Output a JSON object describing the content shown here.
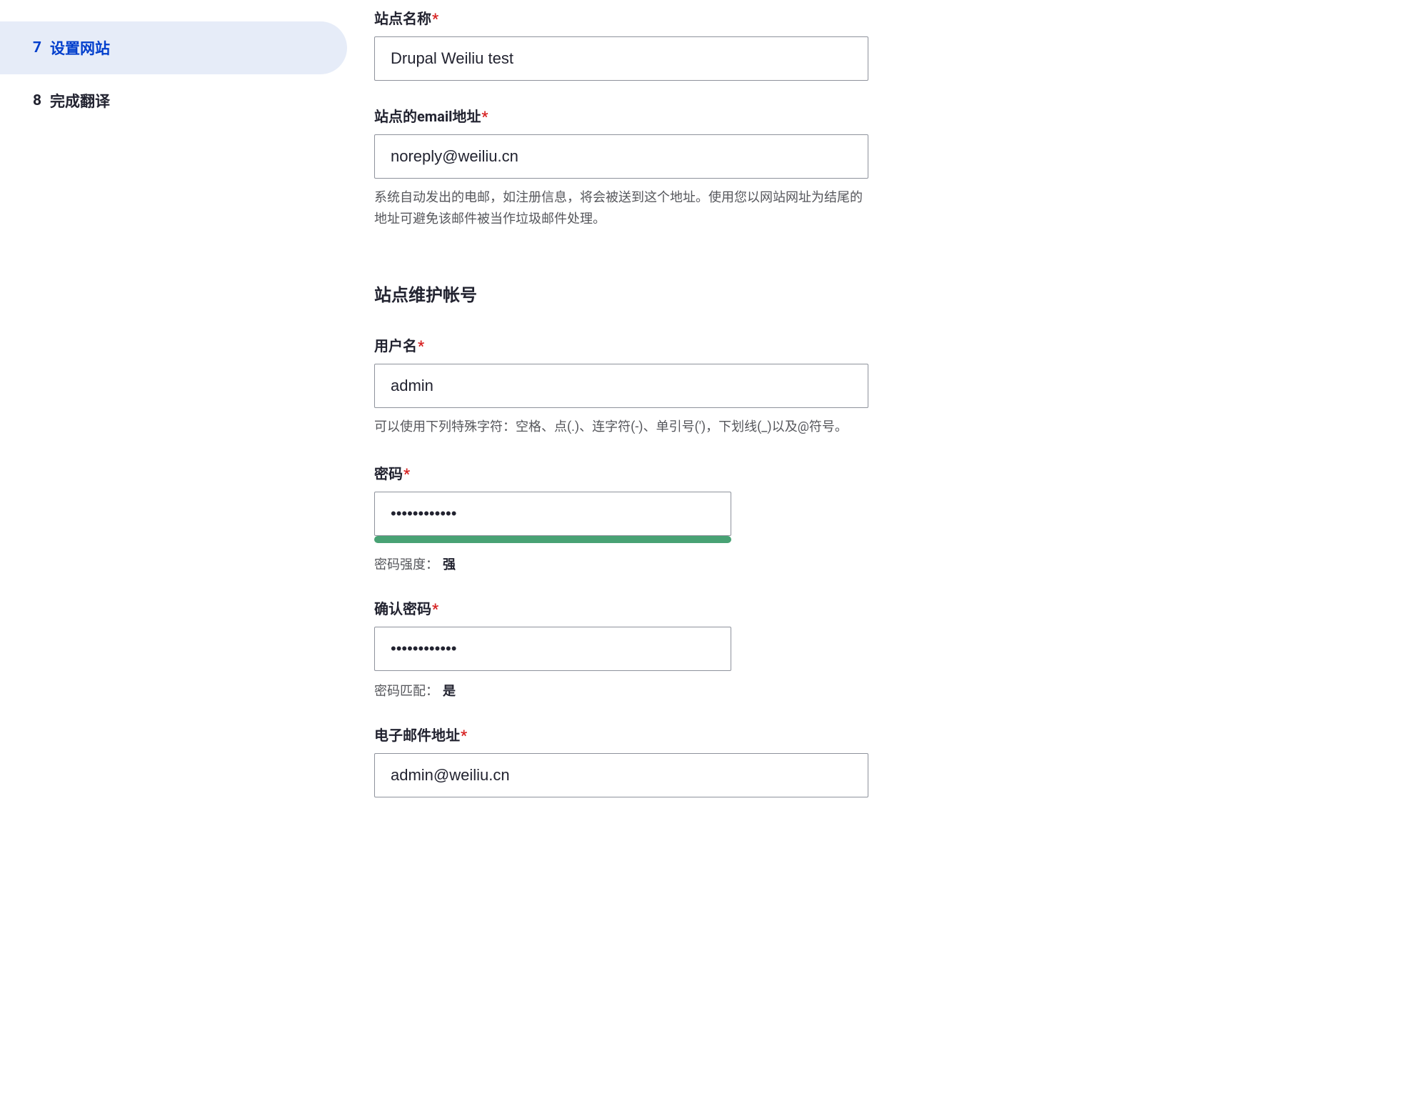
{
  "sidebar": {
    "steps": [
      {
        "number": "7",
        "label": "设置网站",
        "active": true
      },
      {
        "number": "8",
        "label": "完成翻译",
        "active": false
      }
    ]
  },
  "form": {
    "site_name": {
      "label": "站点名称",
      "value": "Drupal Weiliu test"
    },
    "site_email": {
      "label": "站点的email地址",
      "value": "noreply@weiliu.cn",
      "help": "系统自动发出的电邮，如注册信息，将会被送到这个地址。使用您以网站网址为结尾的地址可避免该邮件被当作垃圾邮件处理。"
    },
    "maintenance_heading": "站点维护帐号",
    "username": {
      "label": "用户名",
      "value": "admin",
      "help": "可以使用下列特殊字符：空格、点(.)、连字符(-)、单引号(')，下划线(_)以及@符号。"
    },
    "password": {
      "label": "密码",
      "value": "●●●●●●●●●●●●",
      "strength_label": "密码强度：",
      "strength_value": "强"
    },
    "confirm_password": {
      "label": "确认密码",
      "value": "●●●●●●●●●●●●",
      "match_label": "密码匹配：",
      "match_value": "是"
    },
    "email": {
      "label": "电子邮件地址",
      "value": "admin@weiliu.cn"
    }
  }
}
